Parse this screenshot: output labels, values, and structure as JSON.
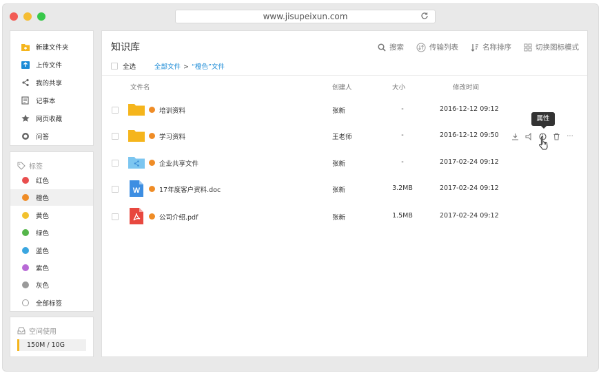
{
  "browser": {
    "url": "www.jisupeixun.com"
  },
  "sidebar": {
    "items": [
      {
        "label": "新建文件夹",
        "icon": "new-folder-icon"
      },
      {
        "label": "上传文件",
        "icon": "upload-icon"
      },
      {
        "label": "我的共享",
        "icon": "share-icon"
      },
      {
        "label": "记事本",
        "icon": "notepad-icon"
      },
      {
        "label": "网页收藏",
        "icon": "star-icon"
      },
      {
        "label": "问答",
        "icon": "qa-icon"
      }
    ],
    "tags_title": "标签",
    "tags": [
      {
        "label": "红色",
        "color": "#e94e4e"
      },
      {
        "label": "橙色",
        "color": "#ef8c26"
      },
      {
        "label": "黄色",
        "color": "#f2c12e"
      },
      {
        "label": "绿色",
        "color": "#55b64a"
      },
      {
        "label": "蓝色",
        "color": "#3aa6e0"
      },
      {
        "label": "紫色",
        "color": "#b86ad6"
      },
      {
        "label": "灰色",
        "color": "#9a9a9a"
      },
      {
        "label": "全部标签",
        "color": ""
      }
    ],
    "active_tag": "橙色",
    "space_title": "空间使用",
    "space_usage": "150M / 10G",
    "space_fraction": 0.015
  },
  "main": {
    "title": "知识库",
    "toolbar": {
      "search": "搜索",
      "transfer": "传输列表",
      "sort": "名称排序",
      "view": "切换图标模式"
    },
    "select_all": "全选",
    "breadcrumb": {
      "root": "全部文件",
      "sep": ">",
      "current": "“橙色”文件"
    },
    "columns": {
      "name": "文件名",
      "creator": "创建人",
      "size": "大小",
      "mtime": "修改时间"
    },
    "files": [
      {
        "name": "培训资料",
        "type": "folder",
        "creator": "张新",
        "size": "-",
        "mtime": "2016-12-12 09:12"
      },
      {
        "name": "学习资料",
        "type": "folder",
        "creator": "王老师",
        "size": "-",
        "mtime": "2016-12-12 09:50"
      },
      {
        "name": "企业共享文件",
        "type": "shared-folder",
        "creator": "张新",
        "size": "-",
        "mtime": "2017-02-24 09:12"
      },
      {
        "name": "17年度客户资料.doc",
        "type": "doc",
        "creator": "张新",
        "size": "3.2MB",
        "mtime": "2017-02-24 09:12"
      },
      {
        "name": "公司介绍.pdf",
        "type": "pdf",
        "creator": "张新",
        "size": "1.5MB",
        "mtime": "2017-02-24 09:12"
      }
    ],
    "tooltip": "属性",
    "row_actions": [
      "download-icon",
      "share-icon",
      "info-icon",
      "delete-icon",
      "more-icon"
    ],
    "more_label": "···"
  }
}
